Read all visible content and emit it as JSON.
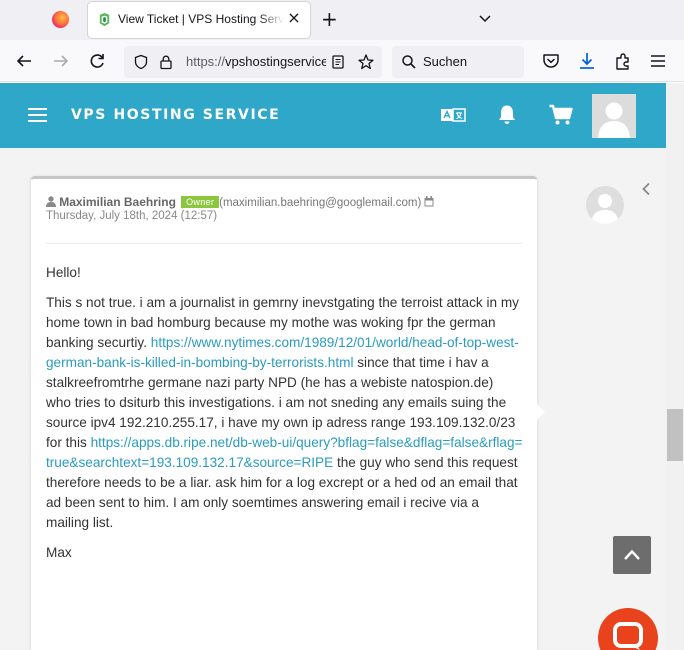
{
  "browser": {
    "tab": {
      "title": "View Ticket | VPS Hosting Service"
    },
    "url": {
      "scheme": "https://",
      "host": "vpshostingservice.co"
    },
    "search": {
      "placeholder": "Suchen"
    }
  },
  "site": {
    "brand": "VPS HOSTING SERVICE",
    "header_icons": [
      "translate-icon",
      "bell-icon",
      "cart-icon",
      "user-avatar"
    ],
    "accent_color": "#2ea7c8"
  },
  "reply": {
    "author": "Maximilian Baehring",
    "badge": "Owner",
    "email": "(maximilian.baehring@googlemail.com)",
    "date": "Thursday, July 18th, 2024 (12:57)",
    "greeting": "Hello!",
    "body_1": "This s not true. i am a journalist in gemrny inevstgating the terroist attack in my home town in bad homburg because my mothe was woking fpr the german banking securtiy. ",
    "link_1": "https://www.nytimes.com/1989/12/01/world/head-of-top-west-german-bank-is-killed-in-bombing-by-terrorists.html",
    "body_2": " since that time i hav a stalkreefromtrhe germane nazi party NPD (he has a webiste natospion.de)",
    "body_3": "who tries to dsiturb this investigations. i am not sneding any emails suing the",
    "body_4": "source ipv4 192.210.255.17, i have my own ip adress range 193.109.132.0/23 for this",
    "link_2": "https://apps.db.ripe.net/db-web-ui/query?bflag=false&dflag=false&rflag=true&searchtext=193.109.132.17&source=RIPE",
    "body_5": " the guy who send this request therefore needs to be a liar. ask him for a log excrept or a hed od an email that ad been sent to him. I am only soemtimes answering email i recive via a mailing list.",
    "signature": "Max"
  }
}
